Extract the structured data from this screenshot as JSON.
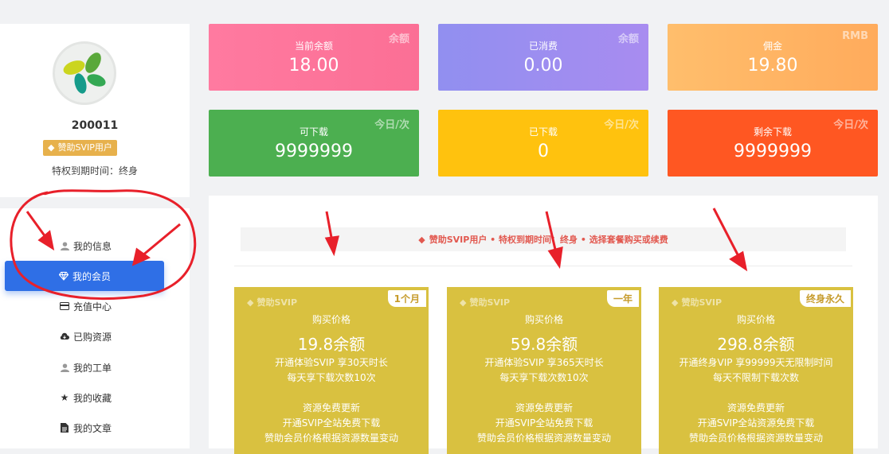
{
  "profile": {
    "username": "200011",
    "vip_badge": "赞助SVIP用户",
    "expire": "特权到期时间：终身"
  },
  "menu": [
    {
      "label": "我的信息",
      "icon": "user-icon",
      "active": false
    },
    {
      "label": "我的会员",
      "icon": "diamond-icon",
      "active": true
    },
    {
      "label": "充值中心",
      "icon": "card-icon",
      "active": false
    },
    {
      "label": "已购资源",
      "icon": "cloud-download-icon",
      "active": false
    },
    {
      "label": "我的工单",
      "icon": "user-icon",
      "active": false
    },
    {
      "label": "我的收藏",
      "icon": "star-icon",
      "active": false
    },
    {
      "label": "我的文章",
      "icon": "file-icon",
      "active": false
    }
  ],
  "stats": [
    {
      "label": "当前余额",
      "value": "18.00",
      "corner": "余额",
      "color": "#fb7299"
    },
    {
      "label": "已消费",
      "value": "0.00",
      "corner": "余额",
      "color": "#9b8cf2"
    },
    {
      "label": "佣金",
      "value": "19.80",
      "corner": "RMB",
      "color": "#ffb162"
    },
    {
      "label": "可下载",
      "value": "9999999",
      "corner": "今日/次",
      "color": "#4caf50"
    },
    {
      "label": "已下载",
      "value": "0",
      "corner": "今日/次",
      "color": "#ffc20e"
    },
    {
      "label": "剩余下载",
      "value": "9999999",
      "corner": "今日/次",
      "color": "#ff5722"
    }
  ],
  "notice": "赞助SVIP用户 • 特权到期时间：终身 • 选择套餐购买或续费",
  "plans": [
    {
      "brand": "赞助SVIP",
      "tag": "1个月",
      "caption": "购买价格",
      "price": "19.8余额",
      "lines": [
        "开通体验SVIP 享30天时长",
        "每天享下载次数10次",
        "",
        "资源免费更新",
        "开通SVIP全站免费下载",
        "赞助会员价格根据资源数量变动"
      ]
    },
    {
      "brand": "赞助SVIP",
      "tag": "一年",
      "caption": "购买价格",
      "price": "59.8余额",
      "lines": [
        "开通体验SVIP 享365天时长",
        "每天享下载次数10次",
        "",
        "资源免费更新",
        "开通SVIP全站免费下载",
        "赞助会员价格根据资源数量变动"
      ]
    },
    {
      "brand": "赞助SVIP",
      "tag": "终身永久",
      "caption": "购买价格",
      "price": "298.8余额",
      "lines": [
        "开通终身VIP 享99999天无限制时间",
        "每天不限制下载次数",
        "",
        "资源免费更新",
        "开通SVIP全站资源免费下载",
        "赞助会员价格根据资源数量变动"
      ]
    }
  ],
  "colors": {
    "accent": "#2f6fe6",
    "plan_bg": "#d9c140",
    "annotation": "#e8202a"
  }
}
